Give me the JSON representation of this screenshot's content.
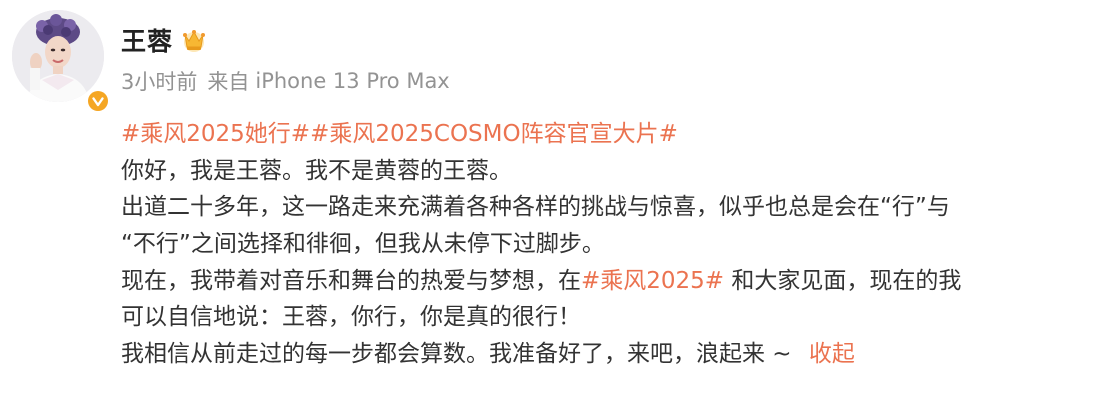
{
  "user": {
    "name": "王蓉",
    "verified": true
  },
  "meta": {
    "time": "3小时前",
    "source_prefix": "来自",
    "device": "iPhone 13 Pro Max"
  },
  "post": {
    "tags": [
      "#乘风2025她行#",
      "#乘风2025COSMO阵容官宣大片#"
    ],
    "line1": "你好，我是王蓉。我不是黄蓉的王蓉。",
    "line2": "出道二十多年，这一路走来充满着各种各样的挑战与惊喜，似乎也总是会在“行”与",
    "line3": "“不行”之间选择和徘徊，但我从未停下过脚步。",
    "line4_before": "现在，我带着对音乐和舞台的热爱与梦想，在",
    "line4_tag": "#乘风2025#",
    "line4_after": " 和大家见面，现在的我",
    "line5": "可以自信地说：王蓉，你行，你是真的很行！",
    "line6": "我相信从前走过的每一步都会算数。我准备好了，来吧，浪起来 ~ ",
    "collapse_label": "收起"
  },
  "colors": {
    "accent": "#eb7350",
    "meta_gray": "#939393",
    "text": "#333333",
    "verified_badge": "#f5a623"
  }
}
